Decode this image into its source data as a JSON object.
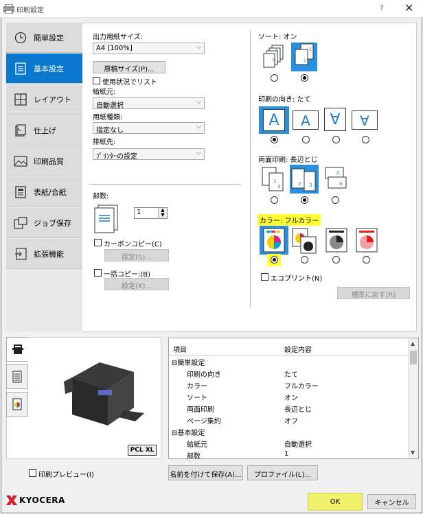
{
  "window": {
    "title": "印刷設定",
    "help_glyph": "?",
    "close_glyph": "✕"
  },
  "sidebar": {
    "items": [
      {
        "label": "簡単設定",
        "icon": "clock-icon"
      },
      {
        "label": "基本設定",
        "icon": "document-icon",
        "active": true
      },
      {
        "label": "レイアウト",
        "icon": "layout-grid-icon"
      },
      {
        "label": "仕上げ",
        "icon": "staple-icon"
      },
      {
        "label": "印刷品質",
        "icon": "image-icon"
      },
      {
        "label": "表紙/合紙",
        "icon": "cover-icon"
      },
      {
        "label": "ジョブ保存",
        "icon": "job-storage-icon"
      },
      {
        "label": "拡張機能",
        "icon": "extension-icon"
      }
    ]
  },
  "basic": {
    "output_size_label": "出力用紙サイズ:",
    "output_size_value": "A4 [100%]",
    "original_size_btn": "原稿サイズ(P)...",
    "use_status_label": "使用状況でリスト",
    "paper_source_label": "給紙元:",
    "paper_source_value": "自動選択",
    "paper_type_label": "用紙種類:",
    "paper_type_value": "指定なし",
    "output_dest_label": "排紙先:",
    "output_dest_value": "ﾌﾟﾘﾝﾀｰの設定",
    "copies_label": "部数:",
    "copies_value": "1",
    "carbon_copy_label": "カーボンコピー(C)",
    "carbon_settings_btn": "設定(S)...",
    "batch_copy_label": "一括コピー:(B)",
    "batch_settings_btn": "設定(K)...",
    "sort_label": "ソート: オン",
    "orientation_label": "印刷の向き: たて",
    "duplex_label": "両面印刷: 長辺とじ",
    "color_label": "カラー: フルカラー",
    "eco_print_label": "エコプリント(N)",
    "restore_btn": "標準に戻す(R)",
    "orient_glyphs": [
      "A",
      "A",
      "∀",
      "∀"
    ]
  },
  "summary": {
    "col_item": "項目",
    "col_value": "設定内容",
    "rows": [
      {
        "indent": 0,
        "item": "⊟簡単設定",
        "value": ""
      },
      {
        "indent": 1,
        "item": "印刷の向き",
        "value": "たて"
      },
      {
        "indent": 1,
        "item": "カラー",
        "value": "フルカラー"
      },
      {
        "indent": 1,
        "item": "ソート",
        "value": "オン"
      },
      {
        "indent": 1,
        "item": "両面印刷",
        "value": "長辺とじ"
      },
      {
        "indent": 1,
        "item": "ページ集約",
        "value": "オフ"
      },
      {
        "indent": 0,
        "item": "⊟基本設定",
        "value": ""
      },
      {
        "indent": 1,
        "item": "給紙元",
        "value": "自動選択"
      },
      {
        "indent": 1,
        "item": "部数",
        "value": "1"
      }
    ]
  },
  "preview": {
    "pcl_badge": "PCL XL",
    "print_preview_label": "印刷プレビュー(I)"
  },
  "footer": {
    "save_as_btn": "名前を付けて保存(A)...",
    "profile_btn": "プロファイル(L)...",
    "logo": "KYOCERA",
    "ok": "OK",
    "cancel": "キャンセル"
  },
  "colors": {
    "accent": "#0a78cf",
    "highlight": "#ffff33",
    "ok_bg": "#f0f06a"
  }
}
